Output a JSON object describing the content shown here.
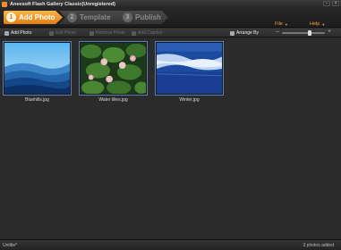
{
  "window": {
    "title": "Aneesoft Flash Gallery Classic(Unregistered)"
  },
  "steps": [
    {
      "num": "1",
      "label": "Add Photo"
    },
    {
      "num": "2",
      "label": "Template"
    },
    {
      "num": "3",
      "label": "Publish"
    }
  ],
  "menus": {
    "file": "File",
    "help": "Help"
  },
  "toolbar": {
    "add_photo": "Add Photo",
    "edit_photo": "Edit Photo",
    "remove_photo": "Remove Photo",
    "add_caption": "Add Caption",
    "arrange_by": "Arrange By"
  },
  "zoom": {
    "level": 0.65
  },
  "photos": [
    {
      "caption": "Bluehills.jpg",
      "icon": "blue-hills-image"
    },
    {
      "caption": "Water lilies.jpg",
      "icon": "water-lilies-image"
    },
    {
      "caption": "Winter.jpg",
      "icon": "winter-image"
    }
  ],
  "status": {
    "left": "Untitle*",
    "right": "3 photos added"
  },
  "colors": {
    "accent": "#e8902a",
    "thumb_border": "#5a7fb5"
  }
}
